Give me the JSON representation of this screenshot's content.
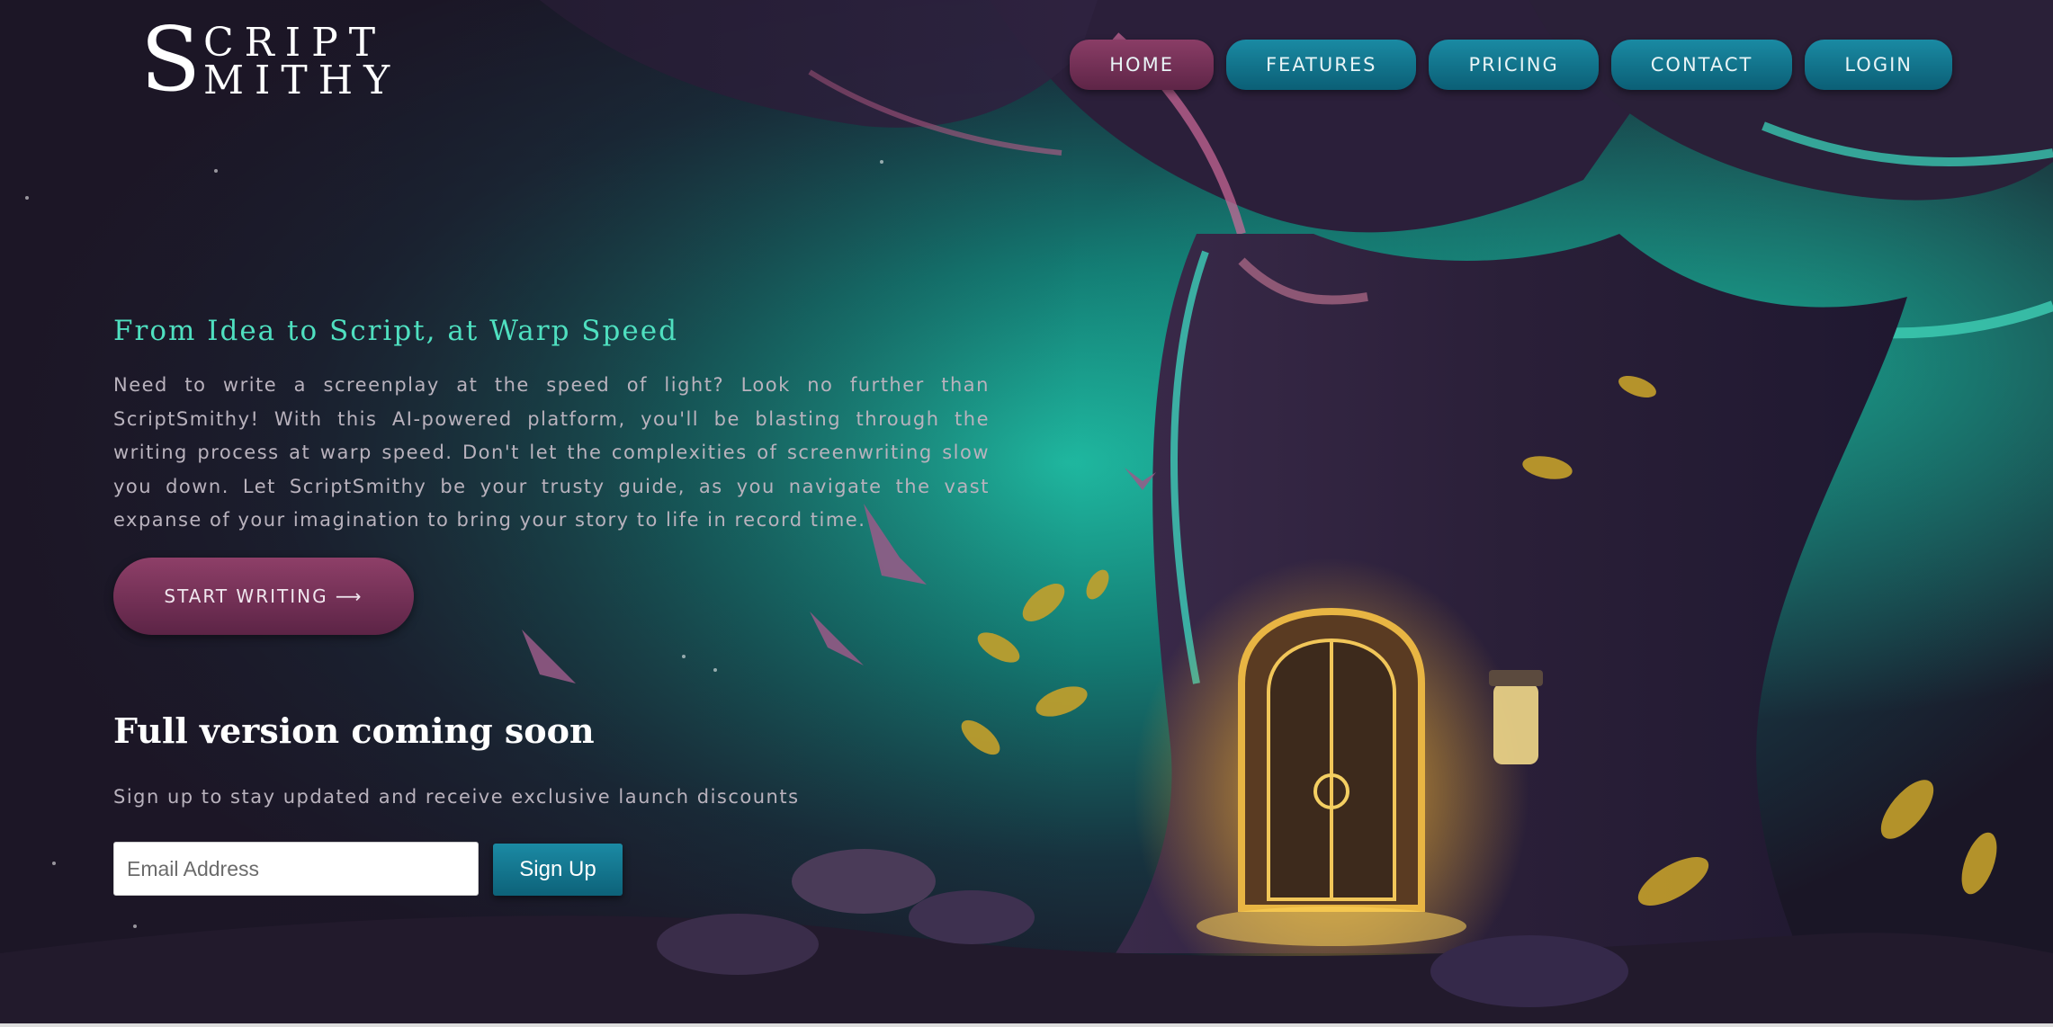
{
  "logo": {
    "initial": "S",
    "line1": "CRIPT",
    "line2": "MITHY"
  },
  "nav": {
    "items": [
      {
        "label": "HOME",
        "active": true
      },
      {
        "label": "FEATURES",
        "active": false
      },
      {
        "label": "PRICING",
        "active": false
      },
      {
        "label": "CONTACT",
        "active": false
      },
      {
        "label": "LOGIN",
        "active": false
      }
    ]
  },
  "hero": {
    "title": "From Idea to Script, at Warp Speed",
    "description": "Need to write a screenplay at the speed of light? Look no further than ScriptSmithy! With this AI-powered platform, you'll be blasting through the writing process at warp speed. Don't let the complexities of screenwriting slow you down. Let ScriptSmithy be your trusty guide, as you navigate the vast expanse of your imagination to bring your story to life in record time.",
    "cta_label": "START WRITING ⟶"
  },
  "signup": {
    "heading": "Full version coming soon",
    "subtext": "Sign up to stay updated and receive exclusive launch discounts",
    "email_placeholder": "Email Address",
    "email_value": "",
    "button_label": "Sign Up"
  },
  "colors": {
    "accent_teal": "#4fe0c0",
    "nav_teal": "#0f6f88",
    "nav_active_plum": "#7a3459",
    "cta_plum": "#7a3459",
    "signup_button": "#137790"
  },
  "icons": {
    "cta_arrow": "right-arrow-icon"
  }
}
